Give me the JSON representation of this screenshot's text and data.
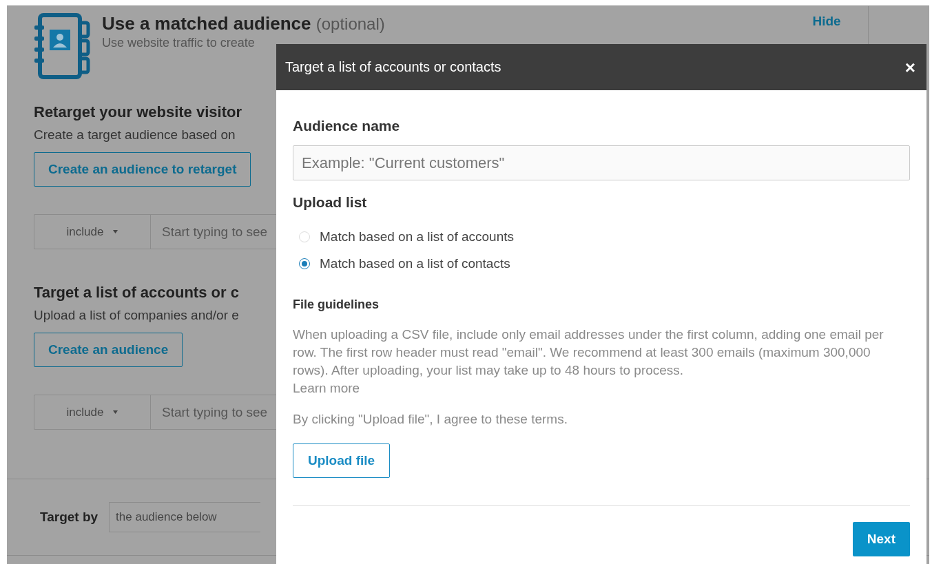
{
  "page": {
    "header": {
      "title": "Use a matched audience",
      "optional": "(optional)",
      "subtitle": "Use website traffic to create",
      "hide_link": "Hide"
    },
    "sections": [
      {
        "heading": "Retarget your website visitor",
        "description": "Create a target audience based on",
        "button": "Create an audience to retarget",
        "filter": {
          "mode": "include",
          "placeholder": "Start typing to see"
        }
      },
      {
        "heading": "Target a list of accounts or c",
        "description": "Upload a list of companies and/or e",
        "button": "Create an audience",
        "filter": {
          "mode": "include",
          "placeholder": "Start typing to see"
        }
      }
    ],
    "target_by": {
      "label": "Target by",
      "value": "the audience below"
    }
  },
  "modal": {
    "title": "Target a list of accounts or contacts",
    "close": "×",
    "name_label": "Audience name",
    "name_placeholder": "Example: \"Current customers\"",
    "upload_label": "Upload list",
    "options": [
      {
        "label": "Match based on a list of accounts",
        "selected": false
      },
      {
        "label": "Match based on a list of contacts",
        "selected": true
      }
    ],
    "guidelines_title": "File guidelines",
    "guidelines": "When uploading a CSV file, include only email addresses under the first column, adding one email per row. The first row header must read \"email\". We recommend at least 300 emails (maximum 300,000 rows). After uploading, your list may take up to 48 hours to process.",
    "learn_more": "Learn more",
    "terms": "By clicking \"Upload file\", I agree to these terms.",
    "upload_button": "Upload file",
    "next_button": "Next"
  }
}
